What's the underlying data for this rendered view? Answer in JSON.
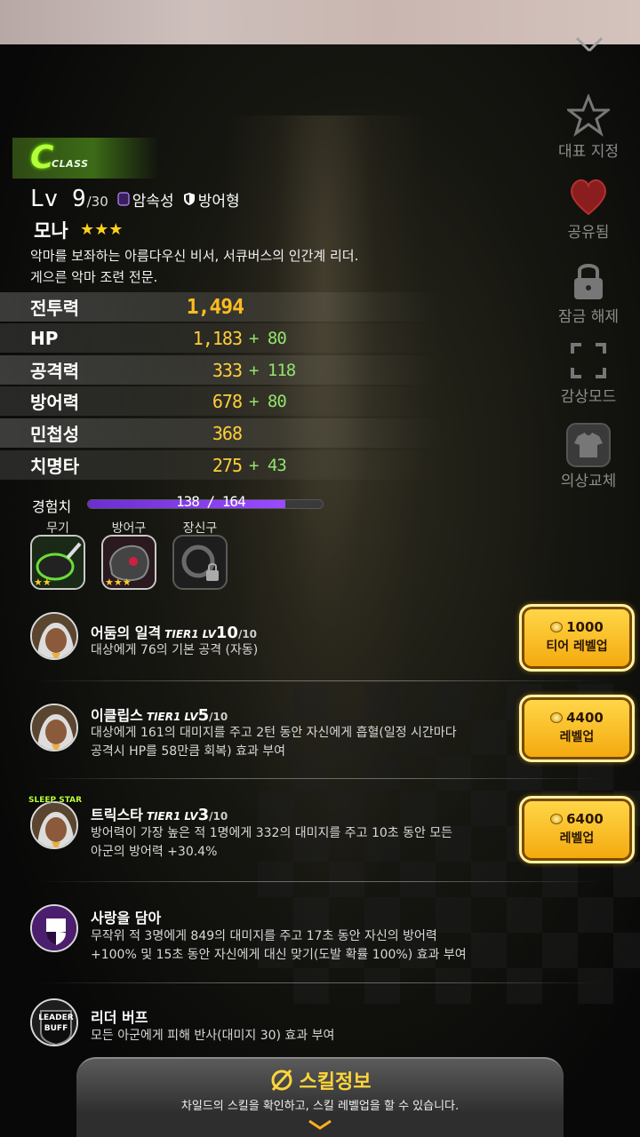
{
  "window": {
    "close_icon": "close-icon"
  },
  "side_menu": [
    {
      "label": "대표 지정",
      "icon": "star-icon"
    },
    {
      "label": "공유됨",
      "icon": "heart-icon"
    },
    {
      "label": "잠금 해제",
      "icon": "lock-icon"
    },
    {
      "label": "감상모드",
      "icon": "fullscreen-icon"
    },
    {
      "label": "의상교체",
      "icon": "outfit-icon"
    }
  ],
  "character": {
    "class_letter": "C",
    "class_text": "CLASS",
    "level": "Lv 9",
    "level_max": "/30",
    "element": "암속성",
    "role": "방어형",
    "name": "모나",
    "star_count": 3,
    "stars": "★★★",
    "description": [
      "악마를 보좌하는 아름다우신 비서, 서큐버스의 인간계 리더.",
      "게으른 악마 조련 전문."
    ]
  },
  "stats": [
    {
      "name": "전투력",
      "value": "1,494",
      "bonus": ""
    },
    {
      "name": "HP",
      "value": "1,183",
      "bonus": "+ 80"
    },
    {
      "name": "공격력",
      "value": "333",
      "bonus": "+ 118"
    },
    {
      "name": "방어력",
      "value": "678",
      "bonus": "+ 80"
    },
    {
      "name": "민첩성",
      "value": "368",
      "bonus": ""
    },
    {
      "name": "치명타",
      "value": "275",
      "bonus": "+ 43"
    }
  ],
  "experience": {
    "label": "경험치",
    "text": "138 / 164",
    "current": 138,
    "max": 164
  },
  "equipment": [
    {
      "label": "무기",
      "stars": "★★",
      "locked": false
    },
    {
      "label": "방어구",
      "stars": "★★★",
      "locked": false
    },
    {
      "label": "장신구",
      "stars": "",
      "locked": true
    }
  ],
  "skills": [
    {
      "name": "어둠의 일격",
      "tier": "TIER1",
      "lv_label": "LV",
      "lv": "10",
      "lv_max": "/10",
      "desc": [
        "대상에게 76의 기본 공격 (자동)"
      ],
      "button": {
        "cost": "1000",
        "label": "티어 레벨업"
      }
    },
    {
      "name": "이클립스",
      "tier": "TIER1",
      "lv_label": "LV",
      "lv": "5",
      "lv_max": "/10",
      "desc": [
        "대상에게 161의 대미지를 주고 2턴 동안 자신에게 흡혈(일정 시간마다",
        "공격시 HP를 58만큼 회복) 효과 부여"
      ],
      "button": {
        "cost": "4400",
        "label": "레벨업"
      }
    },
    {
      "name": "트릭스타",
      "tier": "TIER1",
      "lv_label": "LV",
      "lv": "3",
      "lv_max": "/10",
      "badge": "SLEEP STAR",
      "desc": [
        "방어력이 가장 높은 적 1명에게 332의 대미지를 주고 10초 동안 모든",
        "아군의 방어력 +30.4%"
      ],
      "button": {
        "cost": "6400",
        "label": "레벨업"
      }
    },
    {
      "name": "사랑을 담아",
      "desc": [
        "무작위 적 3명에게 849의 대미지를 주고 17초 동안 자신의 방어력",
        "+100% 및 15초 동안 자신에게 대신 맞기(도발 확률 100%) 효과 부여"
      ]
    },
    {
      "name": "리더 버프",
      "badge": "LEADER BUFF",
      "desc": [
        "모든 아군에게 피해 반사(대미지 30) 효과 부여"
      ]
    }
  ],
  "bottom_panel": {
    "title": "스킬정보",
    "desc": "차일드의 스킬을 확인하고, 스킬 레벨업을 할 수 있습니다."
  }
}
